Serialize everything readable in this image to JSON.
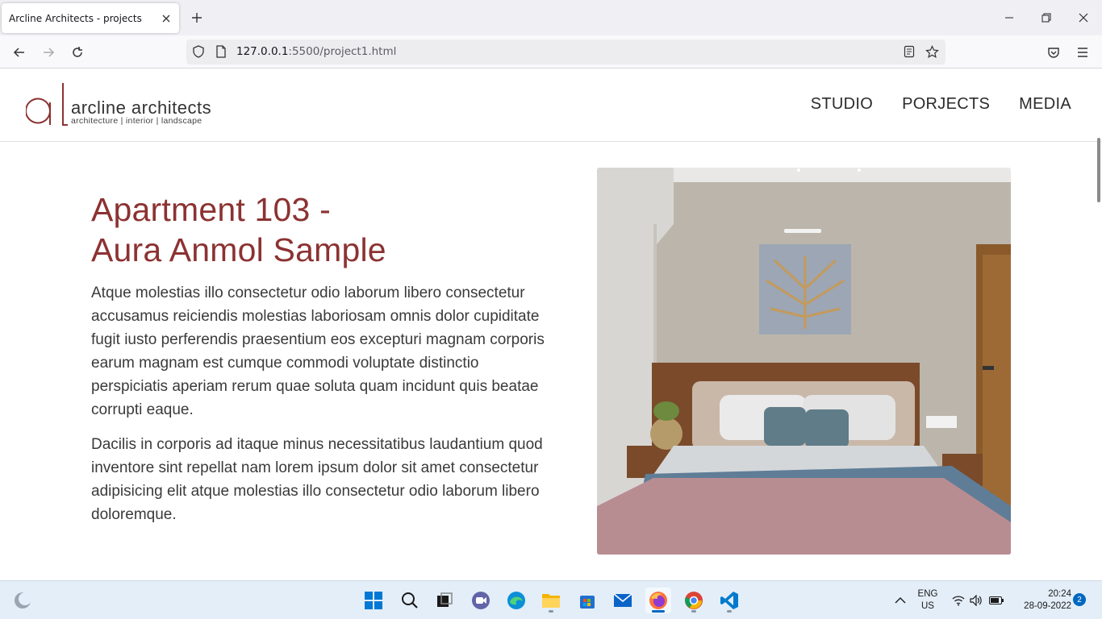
{
  "browser": {
    "tab_title": "Arcline Architects - projects",
    "url_host": "127.0.0.1",
    "url_rest": ":5500/project1.html"
  },
  "site": {
    "brand": "arcline architects",
    "tagline": "architecture  |  interior  |  landscape",
    "nav": [
      "STUDIO",
      "PORJECTS",
      "MEDIA"
    ]
  },
  "project": {
    "title_line1": "Apartment 103 -",
    "title_line2": "Aura Anmol Sample",
    "paragraphs": [
      "Atque molestias illo consectetur odio laborum libero consectetur accusamus reiciendis molestias laboriosam omnis dolor cupiditate fugit iusto perferendis praesentium eos excepturi magnam corporis earum magnam est cumque commodi voluptate distinctio perspiciatis aperiam rerum quae soluta quam incidunt quis beatae corrupti eaque.",
      "Dacilis in corporis ad itaque minus necessitatibus laudantium quod inventore sint repellat nam lorem ipsum dolor sit amet consectetur adipisicing elit atque molestias illo consectetur odio laborum libero doloremque."
    ]
  },
  "taskbar": {
    "lang_line1": "ENG",
    "lang_line2": "US",
    "time": "20:24",
    "date": "28-09-2022",
    "notification_count": "2"
  },
  "colors": {
    "title": "#8c3232",
    "accent": "#0067c0"
  }
}
